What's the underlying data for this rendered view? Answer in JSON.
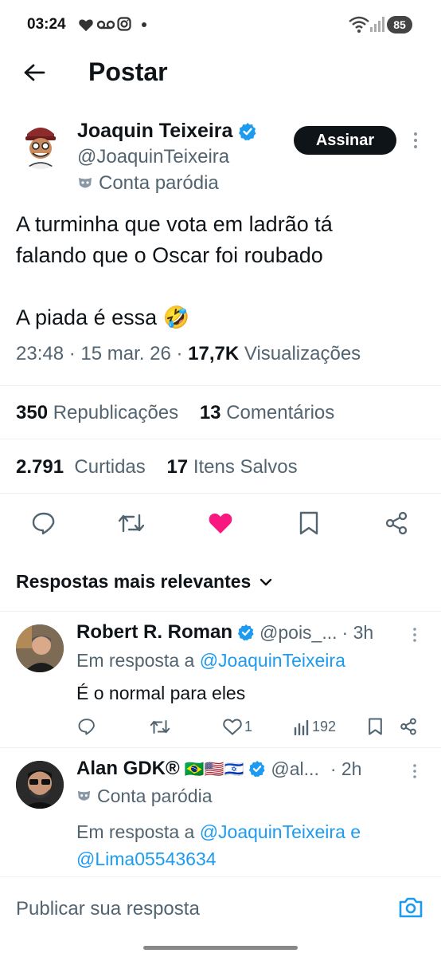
{
  "status_bar": {
    "time": "03:24",
    "battery": "85"
  },
  "header": {
    "title": "Postar"
  },
  "tweet": {
    "author_name": "Joaquin Teixeira",
    "author_handle": "@JoaquinTeixeira",
    "parody_label": "Conta paródia",
    "subscribe_label": "Assinar",
    "text_line1": "A turminha que vota em ladrão tá",
    "text_line2": "falando que o Oscar foi roubado",
    "text_line3": "A piada é essa 🤣",
    "time": "23:48",
    "date": "15 mar. 26",
    "views_count": "17,7K",
    "views_label": "Visualizações",
    "reposts_count": "350",
    "reposts_label": "Republicações",
    "comments_count": "13",
    "comments_label": "Comentários",
    "likes_count": "2.791",
    "likes_label": "Curtidas",
    "saved_count": "17",
    "saved_label": "Itens Salvos"
  },
  "replies_section": {
    "title": "Respostas mais relevantes"
  },
  "replies": [
    {
      "name": "Robert R. Roman",
      "handle": "@pois_...",
      "time": "· 3h",
      "in_reply_prefix": "Em resposta a",
      "in_reply_to": "@JoaquinTeixeira",
      "text": "É o normal para eles",
      "likes": "1",
      "views": "192"
    },
    {
      "name": "Alan GDK®",
      "flags": "🇧🇷🇺🇸🇮🇱",
      "handle": "@al...",
      "time": "· 2h",
      "parody_label": "Conta paródia",
      "in_reply_prefix": "Em resposta a",
      "in_reply_to": "@JoaquinTeixeira e",
      "in_reply_to2": "@Lima05543634"
    }
  ],
  "composer": {
    "placeholder": "Publicar sua resposta"
  },
  "colors": {
    "accent": "#1d9bf0",
    "like": "#f91880",
    "muted": "#536471",
    "verified": "#1d9bf0"
  }
}
